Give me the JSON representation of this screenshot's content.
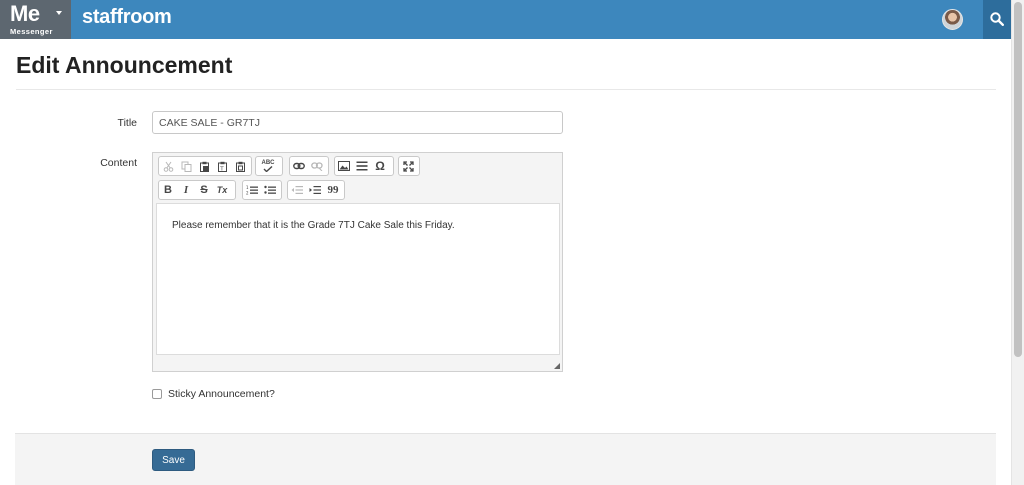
{
  "topbar": {
    "app_name": "Me",
    "app_sub": "Messenger",
    "brand": "staffroom"
  },
  "page": {
    "title": "Edit Announcement"
  },
  "form": {
    "title_label": "Title",
    "title_value": "CAKE SALE - GR7TJ",
    "content_label": "Content",
    "content_text": "Please remember that it is the Grade 7TJ Cake Sale this Friday.",
    "sticky_label": "Sticky Announcement?",
    "sticky_checked": false,
    "save_label": "Save"
  },
  "toolbar": {
    "bold": "B",
    "italic": "I",
    "strike": "S",
    "clear_format": "Tx",
    "spell": "ABC",
    "special_char": "Ω",
    "blockquote": "99"
  },
  "colors": {
    "topbar": "#3d87bd",
    "app_switch": "#5d6770",
    "search": "#2d6d9c",
    "save": "#366b95"
  }
}
